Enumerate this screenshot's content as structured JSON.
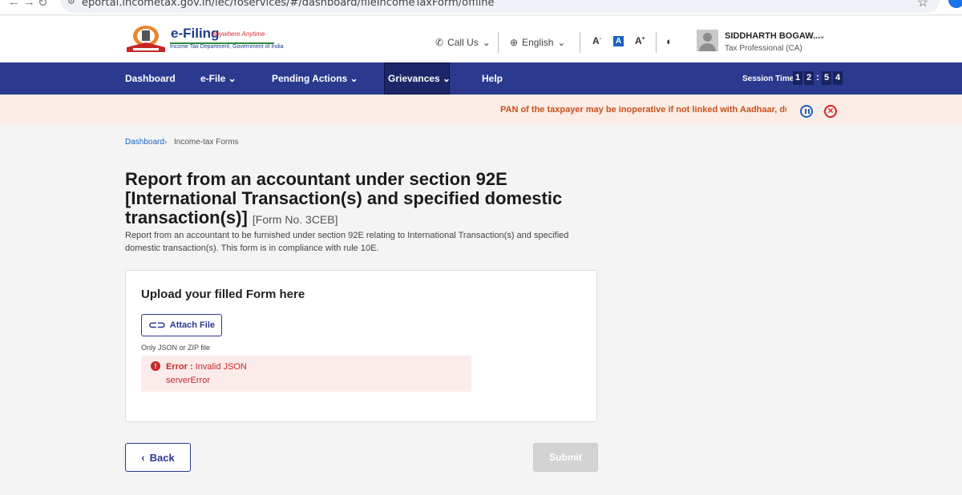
{
  "browser": {
    "url": "eportal.incometax.gov.in/iec/foservices/#/dashboard/fileIncomeTaxForm/offline"
  },
  "header": {
    "logo_title": "e-Filing",
    "logo_tagline": "Anywhere Anytime",
    "logo_sub": "Income Tax Department, Government of India",
    "call_us": "Call Us",
    "language": "English",
    "font_small": "A",
    "font_default": "A",
    "font_large": "A",
    "user_name": "SIDDHARTH BOGAW...",
    "user_role": "Tax Professional (CA)"
  },
  "nav": {
    "items": [
      "Dashboard",
      "e-File",
      "Pending Actions",
      "Grievances",
      "Help"
    ],
    "session_label": "Session Time",
    "session_digits": [
      "1",
      "2",
      "5",
      "4"
    ]
  },
  "notice": {
    "text": "PAN of the taxpayer may be inoperative if not linked with Aadhaar, due"
  },
  "breadcrumb": {
    "home": "Dashboard",
    "current": "Income-tax Forms"
  },
  "page": {
    "title": "Report from an accountant under section 92E [International Transaction(s) and specified domestic transaction(s)]",
    "form_no": "[Form No. 3CEB]",
    "description": "Report from an accountant to be furnished under section 92E relating to International Transaction(s) and specified domestic transaction(s). This form is in compliance with rule 10E."
  },
  "upload": {
    "title": "Upload your filled Form here",
    "attach_label": "Attach File",
    "hint": "Only JSON or ZIP file",
    "error_label": "Error :",
    "error_message": "Invalid JSON",
    "error_detail": "serverError"
  },
  "actions": {
    "back": "Back",
    "submit": "Submit"
  },
  "colors": {
    "nav_bg": "#2b3a8f",
    "notice_bg": "#fbece6",
    "notice_text": "#c9511d",
    "error": "#c62828"
  }
}
